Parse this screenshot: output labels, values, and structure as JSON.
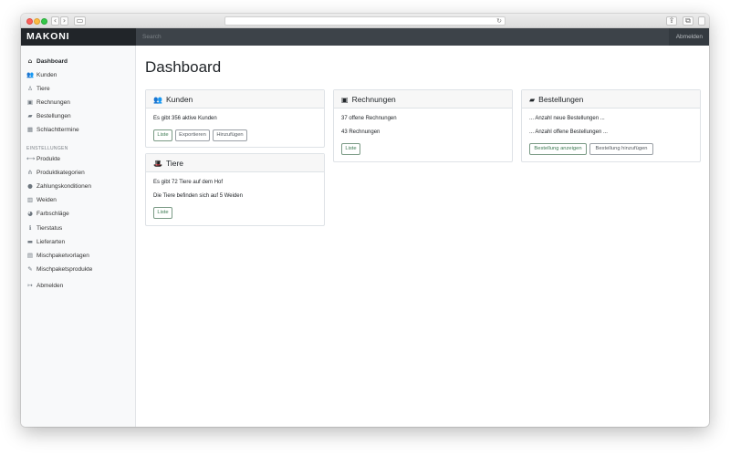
{
  "browser": {
    "back_glyph": "‹",
    "forward_glyph": "›",
    "sidebar_glyph": "▭",
    "reload_glyph": "↻",
    "share_glyph": "⇪",
    "tabs_glyph": "⧉",
    "window_colors": {
      "close": "#fc605b",
      "minimize": "#fdbc40",
      "zoom": "#34c84a"
    }
  },
  "topbar": {
    "brand": "MAKONI",
    "search_placeholder": "Search",
    "logout": "Abmelden"
  },
  "sidebar": {
    "items": [
      {
        "label": "Dashboard",
        "icon": "home-icon",
        "glyph": "⌂"
      },
      {
        "label": "Kunden",
        "icon": "users-icon",
        "glyph": "👥"
      },
      {
        "label": "Tiere",
        "icon": "hat-icon",
        "glyph": "♙"
      },
      {
        "label": "Rechnungen",
        "icon": "money-bill-icon",
        "glyph": "▣"
      },
      {
        "label": "Bestellungen",
        "icon": "folder-icon",
        "glyph": "▰"
      },
      {
        "label": "Schlachttermine",
        "icon": "calendar-icon",
        "glyph": "▦"
      }
    ],
    "section_heading": "EINSTELLUNGEN",
    "settings_items": [
      {
        "label": "Produkte",
        "icon": "dumbbell-icon",
        "glyph": "⟷"
      },
      {
        "label": "Produktkategorien",
        "icon": "sitemap-icon",
        "glyph": "⋔"
      },
      {
        "label": "Zahlungskonditionen",
        "icon": "info-circle-icon",
        "glyph": "●"
      },
      {
        "label": "Weiden",
        "icon": "map-icon",
        "glyph": "▥"
      },
      {
        "label": "Farbschläge",
        "icon": "palette-icon",
        "glyph": "◕"
      },
      {
        "label": "Tierstatus",
        "icon": "info-icon",
        "glyph": "ℹ"
      },
      {
        "label": "Lieferarten",
        "icon": "truck-icon",
        "glyph": "▬"
      },
      {
        "label": "Mischpaketvorlagen",
        "icon": "file-icon",
        "glyph": "▤"
      },
      {
        "label": "Mischpaketsprodukte",
        "icon": "pencil-ruler-icon",
        "glyph": "✎"
      }
    ],
    "logout": {
      "label": "Abmelden",
      "icon": "sign-out-icon",
      "glyph": "↦"
    }
  },
  "main": {
    "title": "Dashboard",
    "cards": {
      "kunden": {
        "title": "Kunden",
        "icon": "users-icon",
        "glyph": "👥",
        "lines": [
          "Es gibt 356 aktive Kunden"
        ],
        "buttons": [
          "Liste",
          "Exportieren",
          "Hinzufügen"
        ]
      },
      "tiere": {
        "title": "Tiere",
        "icon": "hat-cowboy-icon",
        "glyph": "🎩",
        "lines": [
          "Es gibt 72 Tiere auf dem Hof",
          "Die Tiere befinden sich auf 5 Weiden"
        ],
        "buttons": [
          "Liste"
        ]
      },
      "rechnungen": {
        "title": "Rechnungen",
        "icon": "money-bill-icon",
        "glyph": "▣",
        "lines": [
          "37 offene Rechnungen",
          "43 Rechnungen"
        ],
        "buttons": [
          "Liste"
        ]
      },
      "bestellungen": {
        "title": "Bestellungen",
        "icon": "folder-open-icon",
        "glyph": "▰",
        "lines": [
          "... Anzahl neue Bestellungen ...",
          "... Anzahl offene Bestellungen ..."
        ],
        "buttons": [
          "Bestellung anzeigen",
          "Bestellung hinzufügen"
        ]
      }
    }
  }
}
